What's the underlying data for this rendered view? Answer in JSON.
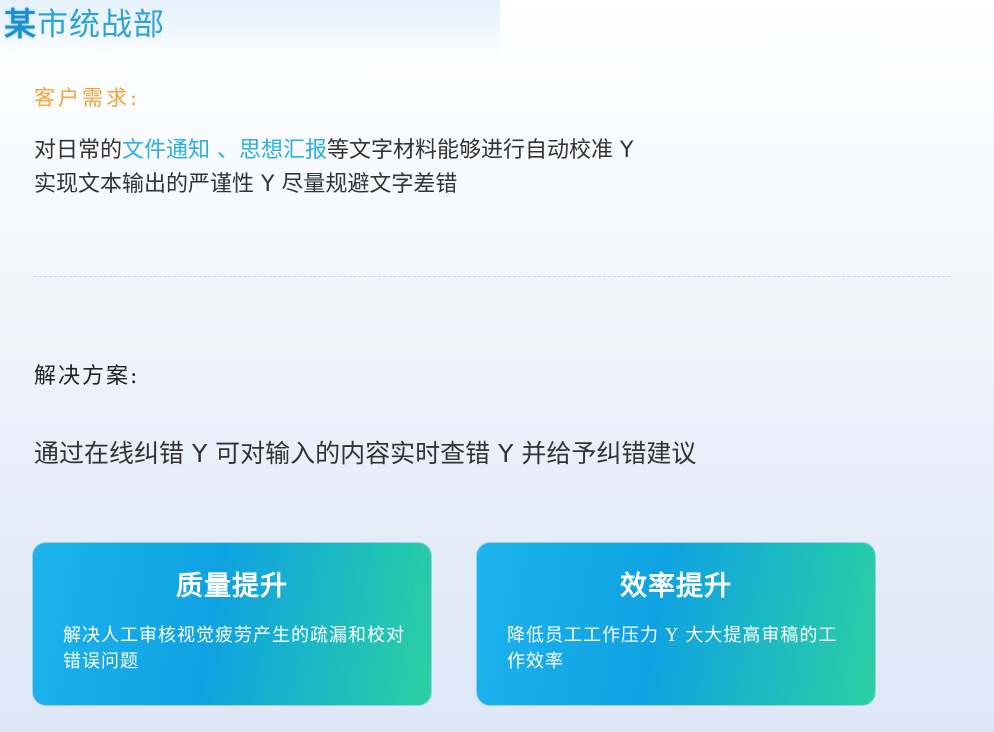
{
  "header": {
    "title_first": "某",
    "title_rest": "市统战部"
  },
  "customer_need": {
    "label": "客户需求:",
    "line1_prefix": "对日常的",
    "line1_highlight": "文件通知 、思想汇报",
    "line1_suffix": "等文字材料能够进行自动校准 Y",
    "line2": "实现文本输出的严谨性 Y  尽量规避文字差错"
  },
  "solution": {
    "label": "解决方案:",
    "text": "通过在线纠错 Y  可对输入的内容实时查错 Y  并给予纠错建议"
  },
  "cards": [
    {
      "title": "质量提升",
      "desc": "解决人工审核视觉疲劳产生的疏漏和校对错误问题"
    },
    {
      "title": "效率提升",
      "desc": "降低员工工作压力 Y  大大提高审稿的工作效率"
    }
  ],
  "colors": {
    "accent_orange": "#f2a43c",
    "highlight_blue": "#2ab0e3",
    "card_gradient_start": "#1db3ee",
    "card_gradient_end": "#2bd0a2"
  }
}
